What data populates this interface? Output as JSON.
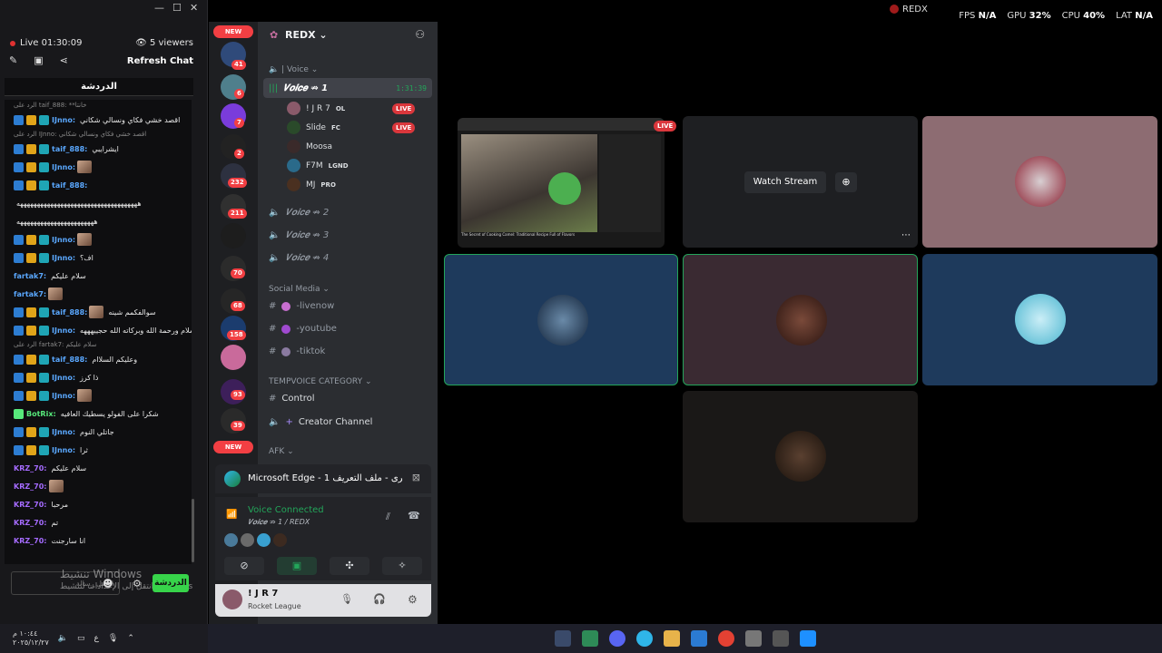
{
  "chat_window": {
    "controls": [
      "—",
      "☐",
      "✕"
    ],
    "live_time": "Live 01:30:09",
    "viewers": "5 viewers",
    "refresh": "Refresh Chat",
    "title": "الدردشة",
    "messages": [
      {
        "reply": "الرد على taif_888: **خانتا"
      },
      {
        "user": "IJnno:",
        "text": "اقصد خشي فكاي ونسالي شكاني",
        "color": "blue",
        "badges": 3
      },
      {
        "reply": "الرد على IJnno: اقصد خشي فكاي ونسالي شكاني"
      },
      {
        "user": "taif_888:",
        "text": "ايشرايبي",
        "color": "blue",
        "badges": 3
      },
      {
        "user": "IJnno:",
        "text": "",
        "color": "blue",
        "badges": 3,
        "thumb": true
      },
      {
        "user": "taif_888:",
        "text": "",
        "color": "blue",
        "badges": 3
      },
      {
        "text": "ههههههههههههههههههههههههههههههههههههه"
      },
      {
        "text": "هههههههههههههههههههههههه"
      },
      {
        "user": "IJnno:",
        "text": "",
        "color": "blue",
        "badges": 3,
        "thumb": true
      },
      {
        "user": "IJnno:",
        "text": "اف؟",
        "color": "blue",
        "badges": 3
      },
      {
        "user": "fartak7:",
        "text": "سلام عليكم",
        "color": "blue",
        "badges": 0
      },
      {
        "user": "fartak7:",
        "text": "",
        "color": "blue",
        "badges": 0,
        "thumb": true
      },
      {
        "user": "taif_888:",
        "text": "سوالفكمم شينه",
        "color": "blue",
        "badges": 3,
        "thumb": true
      },
      {
        "user": "IJnno:",
        "text": "وعليكم السلام ورحمة الله وبركاته الله حجييهههه",
        "color": "blue",
        "badges": 3
      },
      {
        "reply": "الرد على fartak7: سلام عليكم"
      },
      {
        "user": "taif_888:",
        "text": "وعليكم السلاام",
        "color": "blue",
        "badges": 3
      },
      {
        "user": "IJnno:",
        "text": "ذا كرز",
        "color": "blue",
        "badges": 3
      },
      {
        "user": "IJnno:",
        "text": "",
        "color": "blue",
        "badges": 3,
        "thumb": true
      },
      {
        "user": "BotRix:",
        "text": "شكرا على الفولو يسطيك العافيه",
        "color": "green",
        "badges": 1
      },
      {
        "user": "IJnno:",
        "text": "جاتلي النوم",
        "color": "blue",
        "badges": 3
      },
      {
        "user": "IJnno:",
        "text": "ثرا",
        "color": "blue",
        "badges": 3
      },
      {
        "user": "KRZ_70:",
        "text": "سلام عليكم",
        "color": "purple",
        "badges": 0
      },
      {
        "user": "KRZ_70:",
        "text": "",
        "color": "purple",
        "badges": 0,
        "thumb": true
      },
      {
        "user": "KRZ_70:",
        "text": "مرحبا",
        "color": "purple",
        "badges": 0
      },
      {
        "user": "KRZ_70:",
        "text": "تم",
        "color": "purple",
        "badges": 0
      },
      {
        "user": "KRZ_70:",
        "text": "انا سارجنت",
        "color": "purple",
        "badges": 0
      }
    ],
    "input_placeholder": "ارسل رسالة",
    "send": "الدردشة",
    "watermark1": "تنشيط Windows",
    "watermark2": "انتقل إلى الإعدادات لتنشيط Windows",
    "tray_time": "١٠:٤٤ م",
    "tray_date": "٢٠٢٥/١٢/٢٧",
    "tray_lang": "ع"
  },
  "discord": {
    "app_title": "REDX",
    "perf": {
      "fps_label": "FPS",
      "fps": "N/A",
      "gpu_label": "GPU",
      "gpu": "32%",
      "cpu_label": "CPU",
      "cpu": "40%",
      "lat_label": "LAT",
      "lat": "N/A"
    },
    "guild_badges": [
      "41",
      "6",
      "7",
      "2",
      "232",
      "211",
      "70",
      "68",
      "158",
      "93",
      "39"
    ],
    "new_label": "NEW",
    "server_name": "REDX ⌄",
    "voice_category": "| Voice ⌄",
    "active_channel": "𝑽𝒐𝒊𝒄𝒆 ⇏ 1",
    "active_timer": "1:31:39",
    "voice_users": [
      {
        "name": "! J R 7",
        "tag": "OL",
        "live": true
      },
      {
        "name": "Slide",
        "tag": "FC",
        "live": true
      },
      {
        "name": "Moosa",
        "tag": "",
        "live": false
      },
      {
        "name": "F7M",
        "tag": "LGND",
        "live": false
      },
      {
        "name": "MJ",
        "tag": "PRO",
        "live": false
      }
    ],
    "voice_channels": [
      "𝑽𝒐𝒊𝒄𝒆 ⇏ 2",
      "𝑽𝒐𝒊𝒄𝒆 ⇏ 3",
      "𝑽𝒐𝒊𝒄𝒆 ⇏ 4"
    ],
    "social_category": "Social Media ⌄",
    "social_channels": [
      "-livenow",
      "-youtube",
      "-tiktok"
    ],
    "temp_category": "TEMPVOICE CATEGORY ⌄",
    "temp_channels": [
      "Control",
      "Creator Channel"
    ],
    "afk_category": "AFK ⌄",
    "edge_label": "Microsoft Edge - 1 أخرى - ملف التعريف",
    "voice_connected": "Voice Connected",
    "voice_location": "𝑽𝒐𝒊𝒄𝒆 ⇏ 1 / REDX",
    "user_name": "! J R 7",
    "user_status": "Rocket League",
    "watch_stream": "Watch Stream",
    "live": "LIVE",
    "video_caption": "The Secret of Cooking Camel: Traditional Recipe Full of Flavors"
  },
  "colors": {
    "discord_bg": "#2b2d31",
    "accent_green": "#23a55a",
    "live_red": "#da373c"
  }
}
